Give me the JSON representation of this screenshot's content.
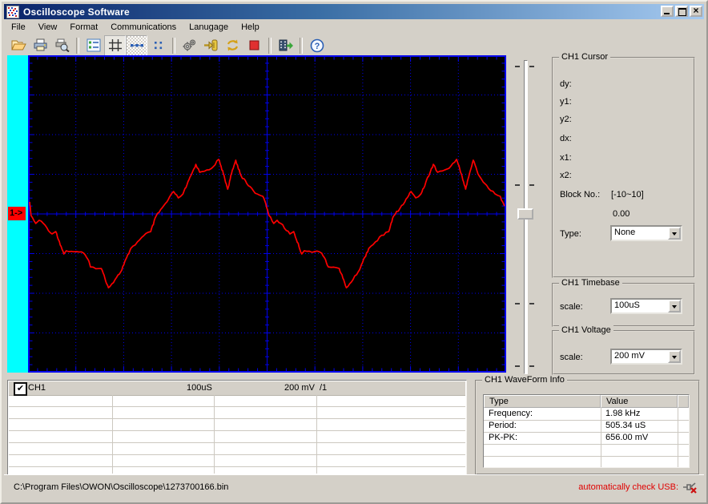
{
  "window": {
    "title": "Oscilloscope Software"
  },
  "menu": {
    "items": [
      "File",
      "View",
      "Format",
      "Communications",
      "Lanugage",
      "Help"
    ]
  },
  "toolbar": {
    "icons": [
      "open-file-icon",
      "print-icon",
      "print-preview-icon",
      "channel-list-icon",
      "grid-toggle-icon",
      "dashed-line-toggle-icon",
      "dots-display-icon",
      "settings-gears-icon",
      "connect-device-icon",
      "refresh-icon",
      "stop-icon",
      "export-record-icon",
      "help-icon"
    ],
    "pressed": [
      "grid-toggle-icon",
      "dashed-line-toggle-icon"
    ]
  },
  "scope": {
    "channel_marker": "1->"
  },
  "cursor_panel": {
    "title": "CH1 Cursor",
    "fields": [
      "dy:",
      "y1:",
      "y2:",
      "dx:",
      "x1:",
      "x2:"
    ],
    "block_label": "Block No.:",
    "block_range": "[-10~10]",
    "block_value": "0.00",
    "type_label": "Type:",
    "type_value": "None"
  },
  "timebase_panel": {
    "title": "CH1 Timebase",
    "scale_label": "scale:",
    "scale_value": "100uS"
  },
  "voltage_panel": {
    "title": "CH1 Voltage",
    "scale_label": "scale:",
    "scale_value": "200 mV"
  },
  "channel_table": {
    "row": {
      "name": "CH1",
      "timebase": "100uS",
      "voltage": "200 mV",
      "probe": "/1",
      "enabled": "✔"
    }
  },
  "waveform_info": {
    "title": "CH1 WaveForm Info",
    "columns": [
      "Type",
      "Value"
    ],
    "rows": [
      [
        "Frequency:",
        "1.98 kHz"
      ],
      [
        "Period:",
        "505.34 uS"
      ],
      [
        "PK-PK:",
        "656.00 mV"
      ]
    ]
  },
  "statusbar": {
    "file_path": "C:\\Program Files\\OWON\\Oscilloscope\\1273700166.bin",
    "usb_label": "automatically check USB:"
  },
  "colors": {
    "window_bg": "#d4d0c8",
    "titlebar_start": "#0a246a",
    "titlebar_end": "#a6caf0",
    "scope_bg": "#000000",
    "grid_blue": "#0000ee",
    "trace_red": "#ff0000",
    "strip_cyan": "#00ffff",
    "marker_bg": "#ff0000",
    "status_red": "#e00000"
  },
  "chart_data": {
    "type": "line",
    "title": "CH1 oscilloscope trace",
    "x_unit": "uS",
    "y_unit": "mV",
    "us_per_div": 100,
    "mv_per_div": 200,
    "x_divisions": 10,
    "y_divisions": 8,
    "xlim": [
      0,
      1000
    ],
    "ylim": [
      -800,
      800
    ],
    "grid": "blue dotted gridlines, ticked center axes, black background",
    "series": [
      {
        "name": "CH1",
        "color": "#ff0000",
        "points": [
          [
            0,
            61
          ],
          [
            3,
            -8
          ],
          [
            13,
            -48
          ],
          [
            20,
            -32
          ],
          [
            29,
            -48
          ],
          [
            47,
            -101
          ],
          [
            55,
            -89
          ],
          [
            72,
            -202
          ],
          [
            77,
            -186
          ],
          [
            99,
            -190
          ],
          [
            114,
            -198
          ],
          [
            123,
            -230
          ],
          [
            128,
            -267
          ],
          [
            151,
            -275
          ],
          [
            166,
            -372
          ],
          [
            180,
            -331
          ],
          [
            192,
            -291
          ],
          [
            213,
            -174
          ],
          [
            227,
            -141
          ],
          [
            249,
            -93
          ],
          [
            255,
            -89
          ],
          [
            266,
            -12
          ],
          [
            289,
            61
          ],
          [
            303,
            113
          ],
          [
            313,
            81
          ],
          [
            323,
            101
          ],
          [
            350,
            250
          ],
          [
            358,
            210
          ],
          [
            373,
            222
          ],
          [
            383,
            230
          ],
          [
            398,
            275
          ],
          [
            408,
            202
          ],
          [
            417,
            125
          ],
          [
            425,
            202
          ],
          [
            434,
            271
          ],
          [
            445,
            194
          ],
          [
            457,
            154
          ],
          [
            471,
            117
          ],
          [
            479,
            101
          ],
          [
            486,
            93
          ],
          [
            491,
            89
          ],
          [
            496,
            61
          ],
          [
            501,
            20
          ],
          [
            504,
            -8
          ],
          [
            514,
            -48
          ],
          [
            521,
            -32
          ],
          [
            529,
            -48
          ],
          [
            548,
            -101
          ],
          [
            556,
            -89
          ],
          [
            573,
            -202
          ],
          [
            578,
            -186
          ],
          [
            600,
            -190
          ],
          [
            615,
            -198
          ],
          [
            623,
            -230
          ],
          [
            629,
            -267
          ],
          [
            652,
            -275
          ],
          [
            667,
            -372
          ],
          [
            681,
            -331
          ],
          [
            692,
            -291
          ],
          [
            714,
            -174
          ],
          [
            728,
            -141
          ],
          [
            750,
            -93
          ],
          [
            756,
            -89
          ],
          [
            766,
            -12
          ],
          [
            790,
            61
          ],
          [
            803,
            113
          ],
          [
            813,
            81
          ],
          [
            824,
            101
          ],
          [
            850,
            250
          ],
          [
            859,
            210
          ],
          [
            874,
            222
          ],
          [
            883,
            230
          ],
          [
            899,
            275
          ],
          [
            909,
            202
          ],
          [
            918,
            125
          ],
          [
            926,
            202
          ],
          [
            934,
            271
          ],
          [
            946,
            194
          ],
          [
            958,
            154
          ],
          [
            971,
            117
          ],
          [
            980,
            101
          ],
          [
            986,
            93
          ],
          [
            991,
            89
          ],
          [
            996,
            61
          ],
          [
            1000,
            40
          ]
        ]
      }
    ]
  }
}
